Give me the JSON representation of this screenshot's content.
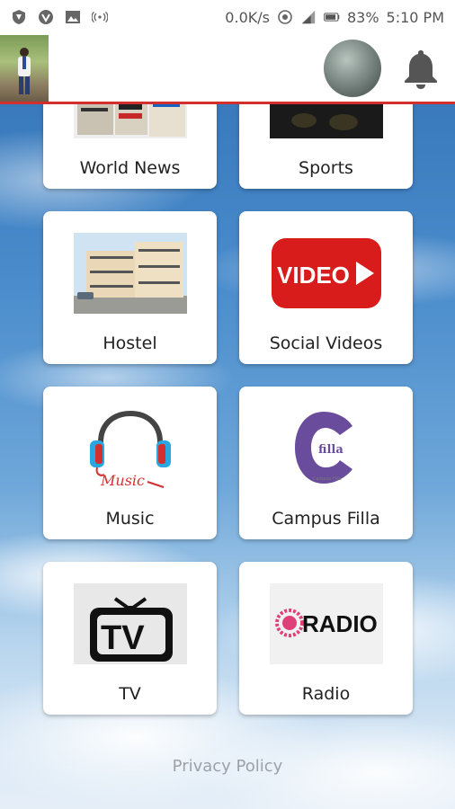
{
  "status_bar": {
    "speed": "0.0K/s",
    "battery": "83%",
    "time": "5:10 PM"
  },
  "header": {
    "profile_alt": "profile photo",
    "notifications_icon": "bell-icon"
  },
  "tiles": [
    {
      "label": "World News",
      "icon": "newspaper-image"
    },
    {
      "label": "Sports",
      "icon": "sports-image"
    },
    {
      "label": "Hostel",
      "icon": "hostel-building-image"
    },
    {
      "label": "Social Videos",
      "icon": "video-play-icon",
      "icon_text": "VIDEO"
    },
    {
      "label": "Music",
      "icon": "headphones-icon",
      "icon_text": "Music"
    },
    {
      "label": "Campus Filla",
      "icon": "campus-filla-logo",
      "icon_text": "filla",
      "icon_subtext": "Campus Filla"
    },
    {
      "label": "TV",
      "icon": "tv-icon",
      "icon_text": "TV"
    },
    {
      "label": "Radio",
      "icon": "radio-logo",
      "icon_text": "RADIO"
    }
  ],
  "footer": {
    "privacy_label": "Privacy Policy"
  },
  "colors": {
    "accent_red": "#d32f2f",
    "video_red": "#d81b1b",
    "filla_purple": "#6a4c9c",
    "radio_pink": "#e0407a"
  }
}
